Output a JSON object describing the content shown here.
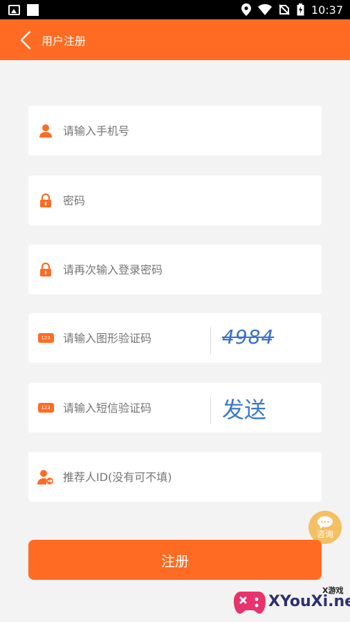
{
  "status_bar": {
    "time": "10:37"
  },
  "app_bar": {
    "title": "用户注册"
  },
  "form": {
    "phone_placeholder": "请输入手机号",
    "password_placeholder": "密码",
    "confirm_password_placeholder": "请再次输入登录密码",
    "captcha_placeholder": "请输入图形验证码",
    "captcha_value": "4984",
    "sms_placeholder": "请输入短信验证码",
    "send_label": "发送",
    "referrer_placeholder": "推荐人ID(没有可不填)",
    "num_badge": "123"
  },
  "actions": {
    "submit_label": "注册",
    "consult_label": "咨询"
  },
  "watermark": {
    "brand": "XYouXi.net",
    "tag": "X游戏"
  },
  "colors": {
    "accent": "#ff6b22",
    "background": "#f3f3f3",
    "link_blue": "#3c78c8",
    "consult_bg": "#f4c063"
  }
}
